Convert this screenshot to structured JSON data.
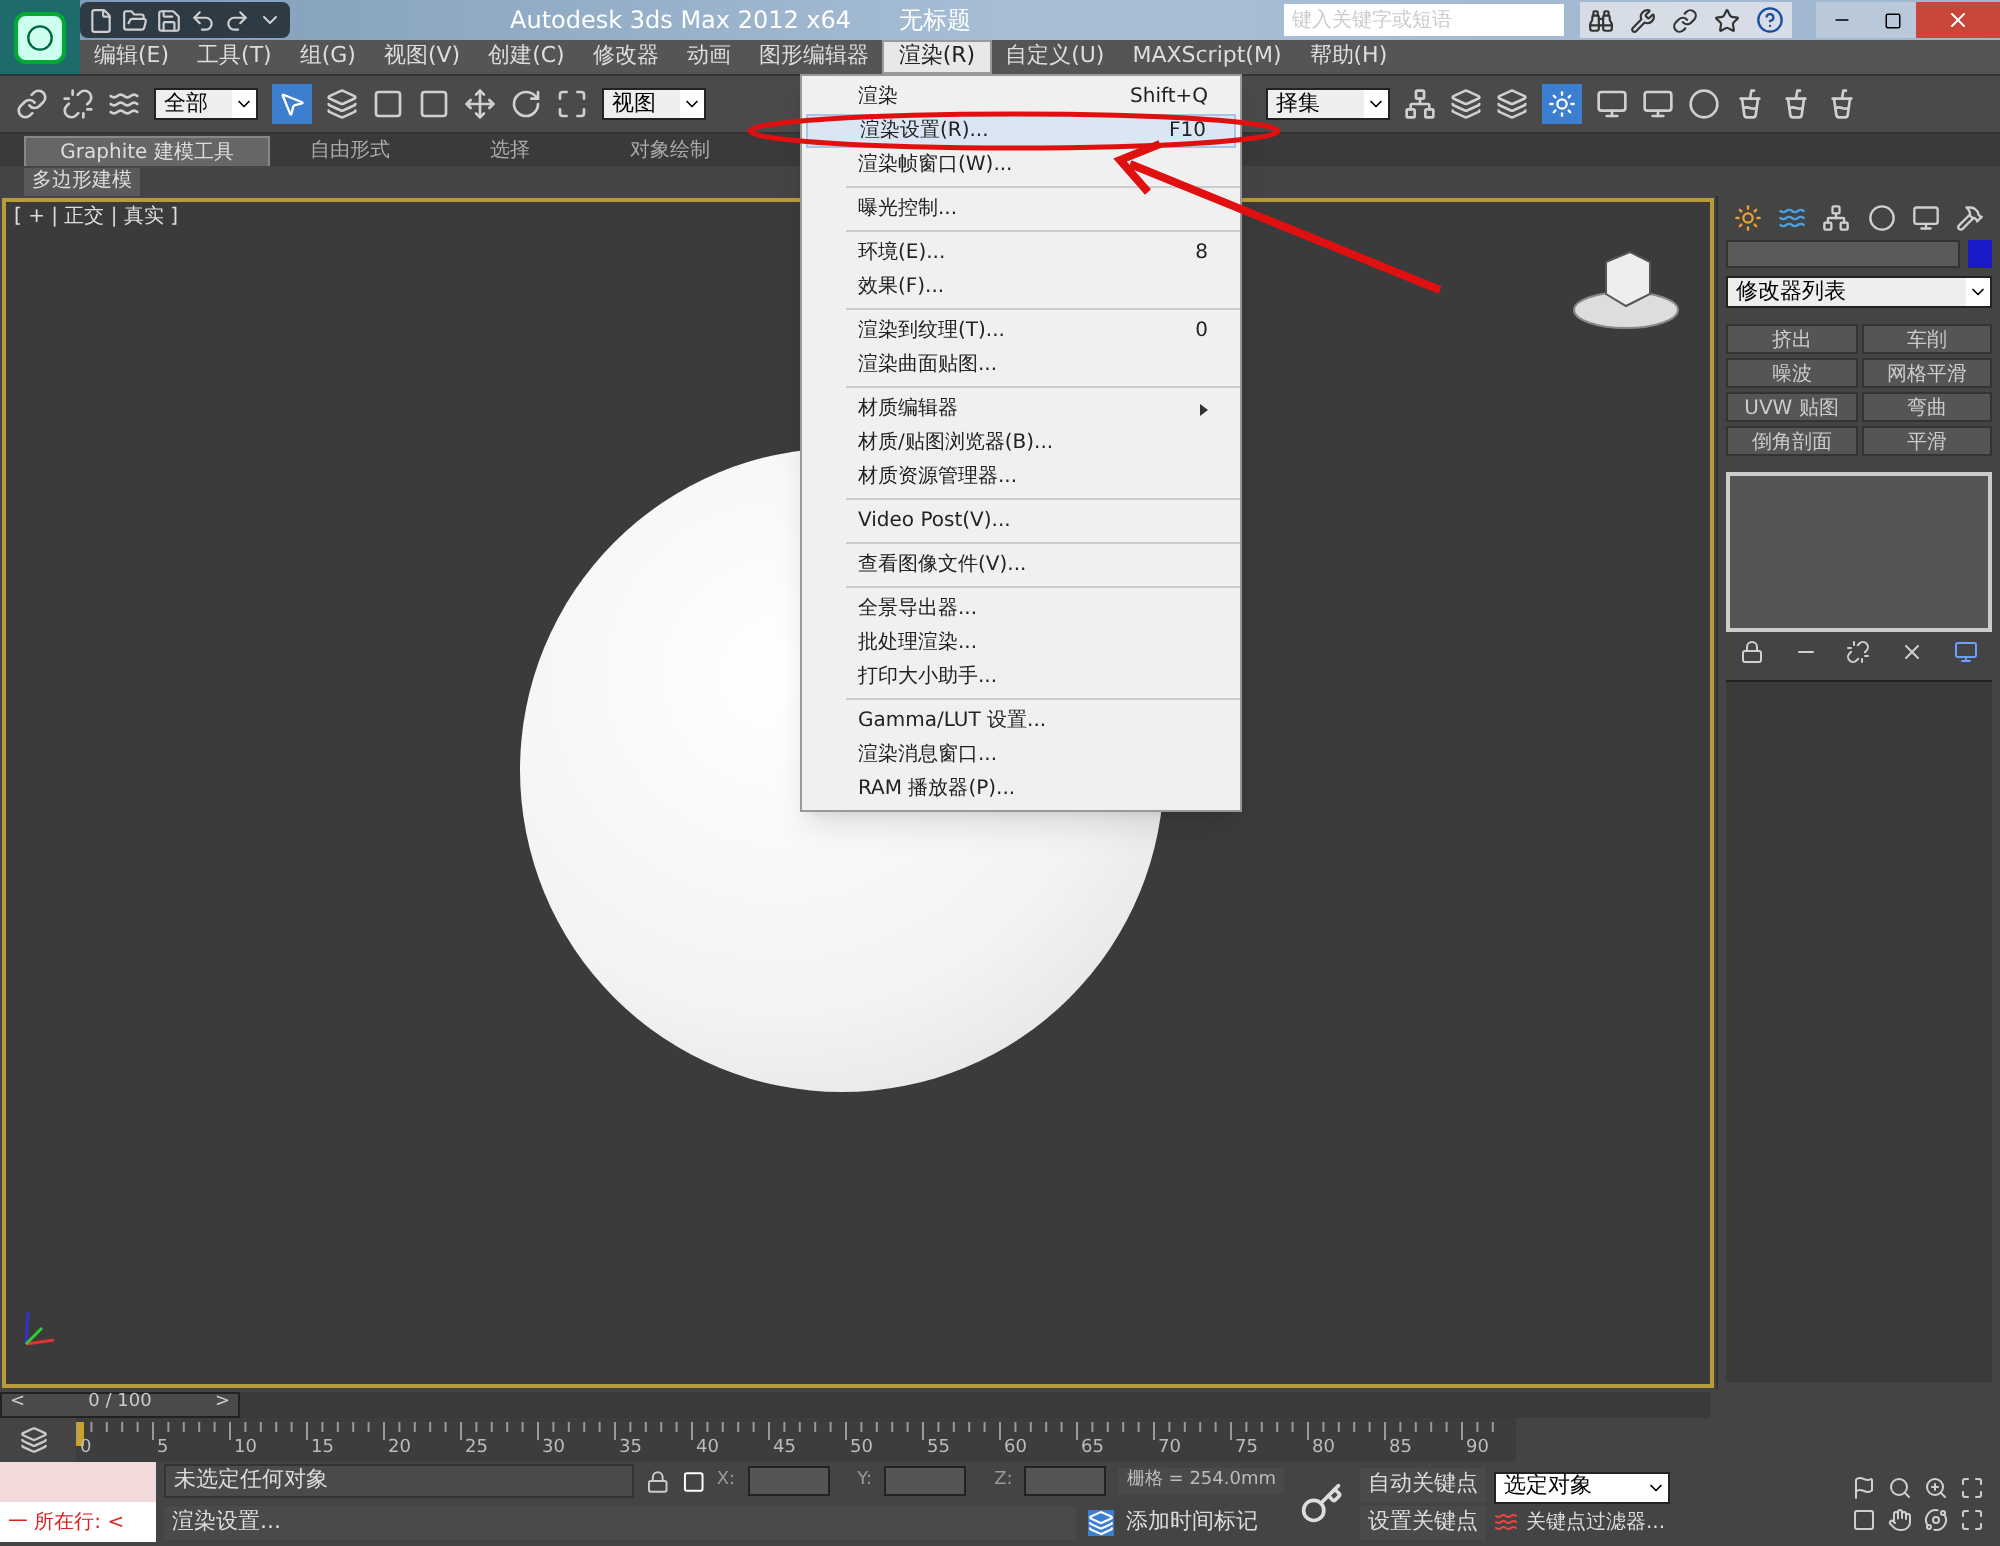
{
  "window": {
    "title": "Autodesk 3ds Max  2012 x64",
    "document": "无标题"
  },
  "search": {
    "placeholder": "键入关键字或短语"
  },
  "menu_bar": [
    {
      "label": "编辑(E)",
      "selected": false
    },
    {
      "label": "工具(T)",
      "selected": false
    },
    {
      "label": "组(G)",
      "selected": false
    },
    {
      "label": "视图(V)",
      "selected": false
    },
    {
      "label": "创建(C)",
      "selected": false
    },
    {
      "label": "修改器",
      "selected": false
    },
    {
      "label": "动画",
      "selected": false
    },
    {
      "label": "图形编辑器",
      "selected": false
    },
    {
      "label": "渲染(R)",
      "selected": true
    },
    {
      "label": "自定义(U)",
      "selected": false
    },
    {
      "label": "MAXScript(M)",
      "selected": false
    },
    {
      "label": "帮助(H)",
      "selected": false
    }
  ],
  "toolbar": {
    "selection_filter": "全部",
    "reference_coord": "视图",
    "named_selection": "择集"
  },
  "ribbon": {
    "tabs": [
      {
        "label": "Graphite 建模工具",
        "selected": true
      },
      {
        "label": "自由形式",
        "selected": false
      },
      {
        "label": "选择",
        "selected": false
      },
      {
        "label": "对象绘制",
        "selected": false
      }
    ],
    "panel": "多边形建模"
  },
  "viewport": {
    "label": "[ + | 正交 | 真实 ]"
  },
  "render_menu": [
    {
      "kind": "item",
      "label": "渲染",
      "shortcut": "Shift+Q",
      "selected": false,
      "submenu": false
    },
    {
      "kind": "item",
      "label": "渲染设置(R)...",
      "shortcut": "F10",
      "selected": true,
      "submenu": false
    },
    {
      "kind": "item",
      "label": "渲染帧窗口(W)...",
      "selected": false,
      "submenu": false
    },
    {
      "kind": "separator"
    },
    {
      "kind": "item",
      "label": "曝光控制...",
      "selected": false,
      "submenu": false
    },
    {
      "kind": "separator"
    },
    {
      "kind": "item",
      "label": "环境(E)...",
      "shortcut": "8",
      "selected": false,
      "submenu": false
    },
    {
      "kind": "item",
      "label": "效果(F)...",
      "selected": false,
      "submenu": false
    },
    {
      "kind": "separator"
    },
    {
      "kind": "item",
      "label": "渲染到纹理(T)...",
      "shortcut": "0",
      "selected": false,
      "submenu": false
    },
    {
      "kind": "item",
      "label": "渲染曲面贴图...",
      "selected": false,
      "submenu": false
    },
    {
      "kind": "separator"
    },
    {
      "kind": "item",
      "label": "材质编辑器",
      "selected": false,
      "submenu": true
    },
    {
      "kind": "item",
      "label": "材质/贴图浏览器(B)...",
      "selected": false,
      "submenu": false
    },
    {
      "kind": "item",
      "label": "材质资源管理器...",
      "selected": false,
      "submenu": false
    },
    {
      "kind": "separator"
    },
    {
      "kind": "item",
      "label": "Video Post(V)...",
      "selected": false,
      "submenu": false
    },
    {
      "kind": "separator"
    },
    {
      "kind": "item",
      "label": "查看图像文件(V)...",
      "selected": false,
      "submenu": false
    },
    {
      "kind": "separator"
    },
    {
      "kind": "item",
      "label": "全景导出器...",
      "selected": false,
      "submenu": false
    },
    {
      "kind": "item",
      "label": "批处理渲染...",
      "selected": false,
      "submenu": false
    },
    {
      "kind": "item",
      "label": "打印大小助手...",
      "selected": false,
      "submenu": false
    },
    {
      "kind": "separator"
    },
    {
      "kind": "item",
      "label": "Gamma/LUT 设置...",
      "selected": false,
      "submenu": false
    },
    {
      "kind": "item",
      "label": "渲染消息窗口...",
      "selected": false,
      "submenu": false
    },
    {
      "kind": "item",
      "label": "RAM 播放器(P)...",
      "selected": false,
      "submenu": false
    }
  ],
  "command_panel": {
    "modifier_list": "修改器列表",
    "modifiers": [
      "挤出",
      "车削",
      "噪波",
      "网格平滑",
      "UVW 贴图",
      "弯曲",
      "倒角剖面",
      "平滑"
    ]
  },
  "timeline": {
    "slider": "0 / 100",
    "prev": "<",
    "next": ">",
    "level": 0,
    "ticks": [
      "0",
      "5",
      "10",
      "15",
      "20",
      "25",
      "30",
      "35",
      "40",
      "45",
      "50",
      "55",
      "60",
      "65",
      "70",
      "75",
      "80",
      "85",
      "90"
    ]
  },
  "status_bar": {
    "listener": "一  所在行:  <",
    "selection": "未选定任何对象",
    "x_label": "X:",
    "y_label": "Y:",
    "z_label": "Z:",
    "grid": "栅格 = 254.0mm",
    "prompt": "渲染设置...",
    "add_time_tag": "添加时间标记",
    "auto_key": "自动关键点",
    "set_key": "设置关键点",
    "key_target": "选定对象",
    "key_filters": "关键点过滤器..."
  }
}
